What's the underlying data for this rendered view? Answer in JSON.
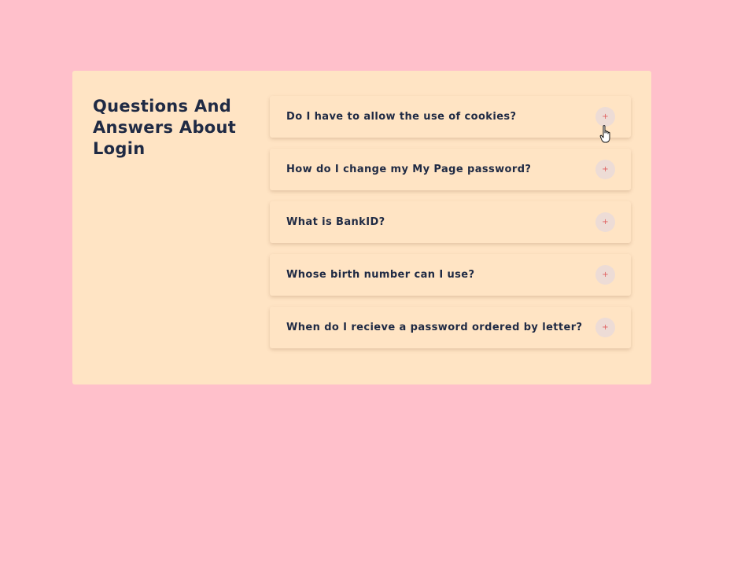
{
  "card": {
    "title": "Questions And Answers About Login",
    "background": "#ffe4c4"
  },
  "page": {
    "background": "#ffc0cb"
  },
  "faq": {
    "items": [
      {
        "question": "Do I have to allow the use of cookies?",
        "icon": "plus-icon",
        "expanded": false
      },
      {
        "question": "How do I change my My Page password?",
        "icon": "plus-icon",
        "expanded": false
      },
      {
        "question": "What is BankID?",
        "icon": "plus-icon",
        "expanded": false
      },
      {
        "question": "Whose birth number can I use?",
        "icon": "plus-icon",
        "expanded": false
      },
      {
        "question": "When do I recieve a password ordered by letter?",
        "icon": "plus-icon",
        "expanded": false
      }
    ],
    "toggle_symbol": "+",
    "accent": "#e05a5a"
  },
  "cursor": {
    "icon": "hand-pointer-icon"
  }
}
